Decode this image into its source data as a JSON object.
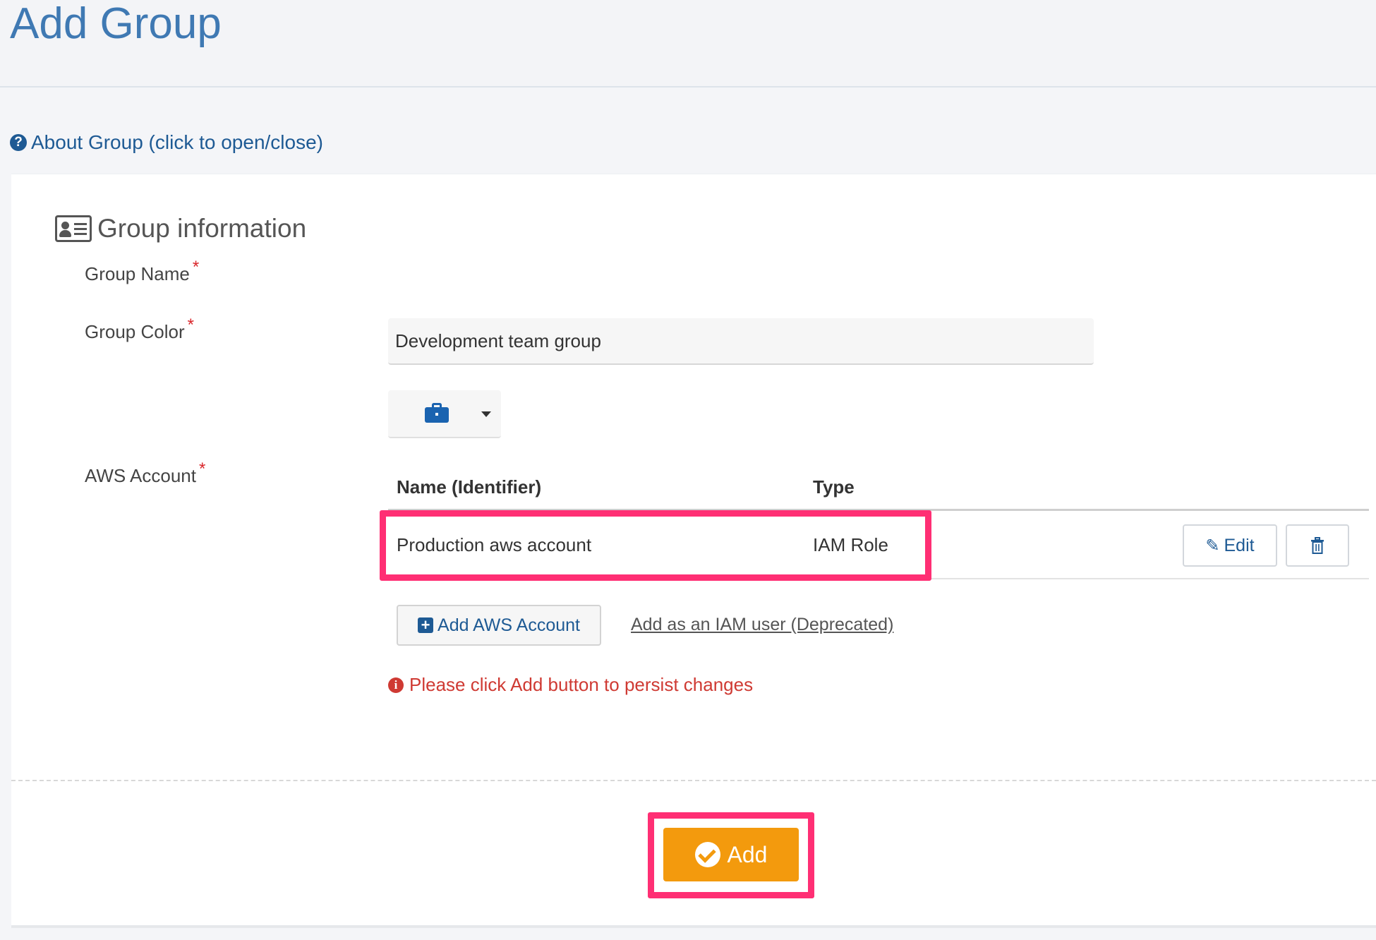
{
  "header": {
    "title": "Add Group"
  },
  "about": {
    "label": "About Group (click to open/close)",
    "icon": "question-circle-icon"
  },
  "section": {
    "title": "Group information",
    "icon": "id-card-icon"
  },
  "form": {
    "group_name": {
      "label": "Group Name",
      "required_mark": "*",
      "value": "Development team group"
    },
    "group_color": {
      "label": "Group Color",
      "required_mark": "*",
      "selected_icon": "briefcase-icon",
      "icon_color": "#1a63b0"
    },
    "aws_account": {
      "label": "AWS Account",
      "required_mark": "*",
      "columns": [
        "Name (Identifier)",
        "Type"
      ],
      "rows": [
        {
          "name": "Production aws account",
          "type": "IAM Role",
          "edit_label": "Edit"
        }
      ],
      "add_button_label": "Add AWS Account",
      "iam_link_label": "Add as an IAM user (Deprecated)"
    }
  },
  "warning": {
    "text": "Please click Add button to persist changes",
    "color": "#cf3a33"
  },
  "footer": {
    "add_label": "Add",
    "accent": "#f39a0d"
  },
  "annotation_color": "#ff2f74"
}
